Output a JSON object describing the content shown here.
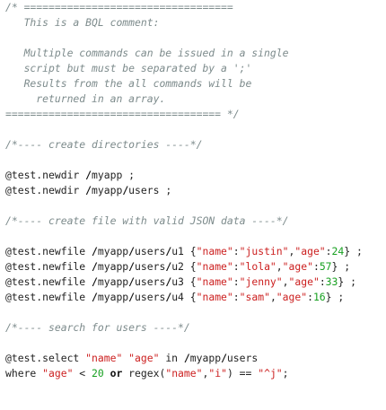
{
  "colors": {
    "comment": "#7d8b8c",
    "string": "#cc2020",
    "number": "#17a020",
    "text": "#222222",
    "background": "#ffffff"
  },
  "lines": [
    [
      {
        "t": "/* ==================================",
        "c": "cmt"
      }
    ],
    [
      {
        "t": "   This is a BQL comment:",
        "c": "cmt"
      }
    ],
    [
      {
        "t": "",
        "c": "plain"
      }
    ],
    [
      {
        "t": "   Multiple commands can be issued in a single",
        "c": "cmt"
      }
    ],
    [
      {
        "t": "   script but must be separated by a ';'",
        "c": "cmt"
      }
    ],
    [
      {
        "t": "   Results from the all commands will be",
        "c": "cmt"
      }
    ],
    [
      {
        "t": "     returned in an array.",
        "c": "cmt"
      }
    ],
    [
      {
        "t": "=================================== */",
        "c": "cmt"
      }
    ],
    [
      {
        "t": "",
        "c": "plain"
      }
    ],
    [
      {
        "t": "/*---- create directories ----*/",
        "c": "cmt"
      }
    ],
    [
      {
        "t": "",
        "c": "plain"
      }
    ],
    [
      {
        "t": "@test.newdir ",
        "c": "plain"
      },
      {
        "t": "/",
        "c": "kw"
      },
      {
        "t": "myapp ;",
        "c": "plain"
      }
    ],
    [
      {
        "t": "@test.newdir ",
        "c": "plain"
      },
      {
        "t": "/",
        "c": "kw"
      },
      {
        "t": "myapp",
        "c": "plain"
      },
      {
        "t": "/",
        "c": "kw"
      },
      {
        "t": "users ;",
        "c": "plain"
      }
    ],
    [
      {
        "t": "",
        "c": "plain"
      }
    ],
    [
      {
        "t": "/*---- create file with valid JSON data ----*/",
        "c": "cmt"
      }
    ],
    [
      {
        "t": "",
        "c": "plain"
      }
    ],
    [
      {
        "t": "@test.newfile ",
        "c": "plain"
      },
      {
        "t": "/",
        "c": "kw"
      },
      {
        "t": "myapp",
        "c": "plain"
      },
      {
        "t": "/",
        "c": "kw"
      },
      {
        "t": "users",
        "c": "plain"
      },
      {
        "t": "/",
        "c": "kw"
      },
      {
        "t": "u1 {",
        "c": "plain"
      },
      {
        "t": "\"name\"",
        "c": "str"
      },
      {
        "t": ":",
        "c": "plain"
      },
      {
        "t": "\"justin\"",
        "c": "str"
      },
      {
        "t": ",",
        "c": "plain"
      },
      {
        "t": "\"age\"",
        "c": "str"
      },
      {
        "t": ":",
        "c": "plain"
      },
      {
        "t": "24",
        "c": "num"
      },
      {
        "t": "} ;",
        "c": "plain"
      }
    ],
    [
      {
        "t": "@test.newfile ",
        "c": "plain"
      },
      {
        "t": "/",
        "c": "kw"
      },
      {
        "t": "myapp",
        "c": "plain"
      },
      {
        "t": "/",
        "c": "kw"
      },
      {
        "t": "users",
        "c": "plain"
      },
      {
        "t": "/",
        "c": "kw"
      },
      {
        "t": "u2 {",
        "c": "plain"
      },
      {
        "t": "\"name\"",
        "c": "str"
      },
      {
        "t": ":",
        "c": "plain"
      },
      {
        "t": "\"lola\"",
        "c": "str"
      },
      {
        "t": ",",
        "c": "plain"
      },
      {
        "t": "\"age\"",
        "c": "str"
      },
      {
        "t": ":",
        "c": "plain"
      },
      {
        "t": "57",
        "c": "num"
      },
      {
        "t": "} ;",
        "c": "plain"
      }
    ],
    [
      {
        "t": "@test.newfile ",
        "c": "plain"
      },
      {
        "t": "/",
        "c": "kw"
      },
      {
        "t": "myapp",
        "c": "plain"
      },
      {
        "t": "/",
        "c": "kw"
      },
      {
        "t": "users",
        "c": "plain"
      },
      {
        "t": "/",
        "c": "kw"
      },
      {
        "t": "u3 {",
        "c": "plain"
      },
      {
        "t": "\"name\"",
        "c": "str"
      },
      {
        "t": ":",
        "c": "plain"
      },
      {
        "t": "\"jenny\"",
        "c": "str"
      },
      {
        "t": ",",
        "c": "plain"
      },
      {
        "t": "\"age\"",
        "c": "str"
      },
      {
        "t": ":",
        "c": "plain"
      },
      {
        "t": "33",
        "c": "num"
      },
      {
        "t": "} ;",
        "c": "plain"
      }
    ],
    [
      {
        "t": "@test.newfile ",
        "c": "plain"
      },
      {
        "t": "/",
        "c": "kw"
      },
      {
        "t": "myapp",
        "c": "plain"
      },
      {
        "t": "/",
        "c": "kw"
      },
      {
        "t": "users",
        "c": "plain"
      },
      {
        "t": "/",
        "c": "kw"
      },
      {
        "t": "u4 {",
        "c": "plain"
      },
      {
        "t": "\"name\"",
        "c": "str"
      },
      {
        "t": ":",
        "c": "plain"
      },
      {
        "t": "\"sam\"",
        "c": "str"
      },
      {
        "t": ",",
        "c": "plain"
      },
      {
        "t": "\"age\"",
        "c": "str"
      },
      {
        "t": ":",
        "c": "plain"
      },
      {
        "t": "16",
        "c": "num"
      },
      {
        "t": "} ;",
        "c": "plain"
      }
    ],
    [
      {
        "t": "",
        "c": "plain"
      }
    ],
    [
      {
        "t": "/*---- search for users ----*/",
        "c": "cmt"
      }
    ],
    [
      {
        "t": "",
        "c": "plain"
      }
    ],
    [
      {
        "t": "@test.select ",
        "c": "plain"
      },
      {
        "t": "\"name\"",
        "c": "str"
      },
      {
        "t": " ",
        "c": "plain"
      },
      {
        "t": "\"age\"",
        "c": "str"
      },
      {
        "t": " in ",
        "c": "plain"
      },
      {
        "t": "/",
        "c": "kw"
      },
      {
        "t": "myapp",
        "c": "plain"
      },
      {
        "t": "/",
        "c": "kw"
      },
      {
        "t": "users",
        "c": "plain"
      }
    ],
    [
      {
        "t": "where ",
        "c": "plain"
      },
      {
        "t": "\"age\"",
        "c": "str"
      },
      {
        "t": " < ",
        "c": "plain"
      },
      {
        "t": "20",
        "c": "num"
      },
      {
        "t": " ",
        "c": "plain"
      },
      {
        "t": "or",
        "c": "kw"
      },
      {
        "t": " regex(",
        "c": "plain"
      },
      {
        "t": "\"name\"",
        "c": "str"
      },
      {
        "t": ",",
        "c": "plain"
      },
      {
        "t": "\"i\"",
        "c": "str"
      },
      {
        "t": ") == ",
        "c": "plain"
      },
      {
        "t": "\"^j\"",
        "c": "str"
      },
      {
        "t": ";",
        "c": "plain"
      }
    ]
  ]
}
